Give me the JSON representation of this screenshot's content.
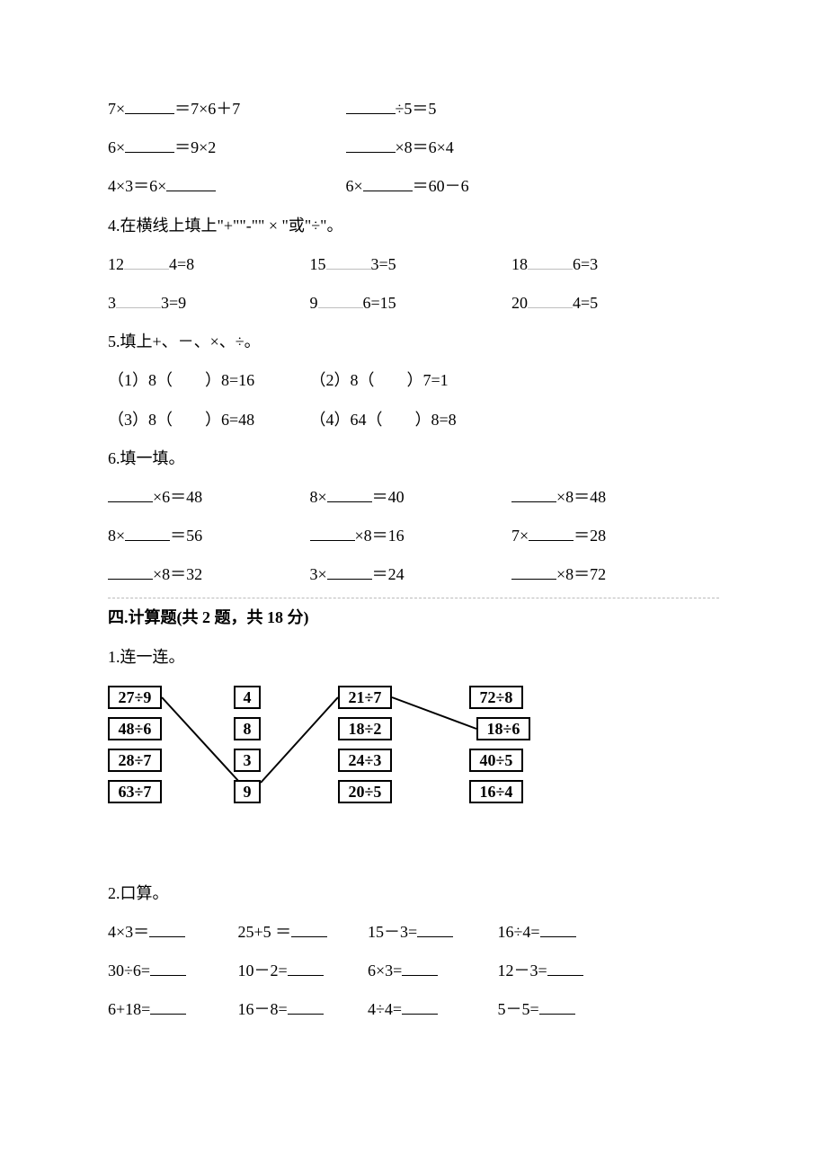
{
  "q3": {
    "r1a_pre": "7×",
    "r1a_post": "＝7×6＋7",
    "r1b_post": "÷5＝5",
    "r2a_pre": "6×",
    "r2a_post": "＝9×2",
    "r2b_post": "×8＝6×4",
    "r3a_pre": "4×3＝6×",
    "r3b_pre": "6×",
    "r3b_post": "＝60－6"
  },
  "q4": {
    "title": "4.在横线上填上\"+\"\"-\"\" × \"或\"÷\"。",
    "r1": {
      "a_pre": "12",
      "a_post": "4=8",
      "b_pre": "15",
      "b_post": "3=5",
      "c_pre": "18",
      "c_post": "6=3"
    },
    "r2": {
      "a_pre": "3",
      "a_post": "3=9",
      "b_pre": "9",
      "b_post": "6=15",
      "c_pre": "20",
      "c_post": "4=5"
    }
  },
  "q5": {
    "title": "5.填上+、－、×、÷。",
    "i1": "（1）8（　　）8=16",
    "i2": "（2）8（　　）7=1",
    "i3": "（3）8（　　）6=48",
    "i4": "（4）64（　　）8=8"
  },
  "q6": {
    "title": "6.填一填。",
    "r1": {
      "a_post": "×6＝48",
      "b_pre": "8×",
      "b_post": "＝40",
      "c_post": "×8＝48"
    },
    "r2": {
      "a_pre": "8×",
      "a_post": "＝56",
      "b_post": "×8＝16",
      "c_pre": "7×",
      "c_post": "＝28"
    },
    "r3": {
      "a_post": "×8＝32",
      "b_pre": "3×",
      "b_post": "＝24",
      "c_post": "×8＝72"
    }
  },
  "sec4": {
    "title": "四.计算题(共 2 题，共 18 分)",
    "q1": "1.连一连。",
    "q2": "2.口算。",
    "matching": {
      "col1": [
        "27÷9",
        "48÷6",
        "28÷7",
        "63÷7"
      ],
      "col2": [
        "4",
        "8",
        "3",
        "9"
      ],
      "col3": [
        "21÷7",
        "18÷2",
        "24÷3",
        "20÷5"
      ],
      "col4": [
        "72÷8",
        "18÷6",
        "40÷5",
        "16÷4"
      ]
    },
    "calc": {
      "r1": {
        "a": "4×3＝",
        "b": "25+5 ＝",
        "c": "15－3=",
        "d": "16÷4="
      },
      "r2": {
        "a": "30÷6=",
        "b": "10－2=",
        "c": "6×3=",
        "d": "12－3="
      },
      "r3": {
        "a": "6+18=",
        "b": "16－8=",
        "c": "4÷4=",
        "d": "5－5="
      }
    }
  }
}
